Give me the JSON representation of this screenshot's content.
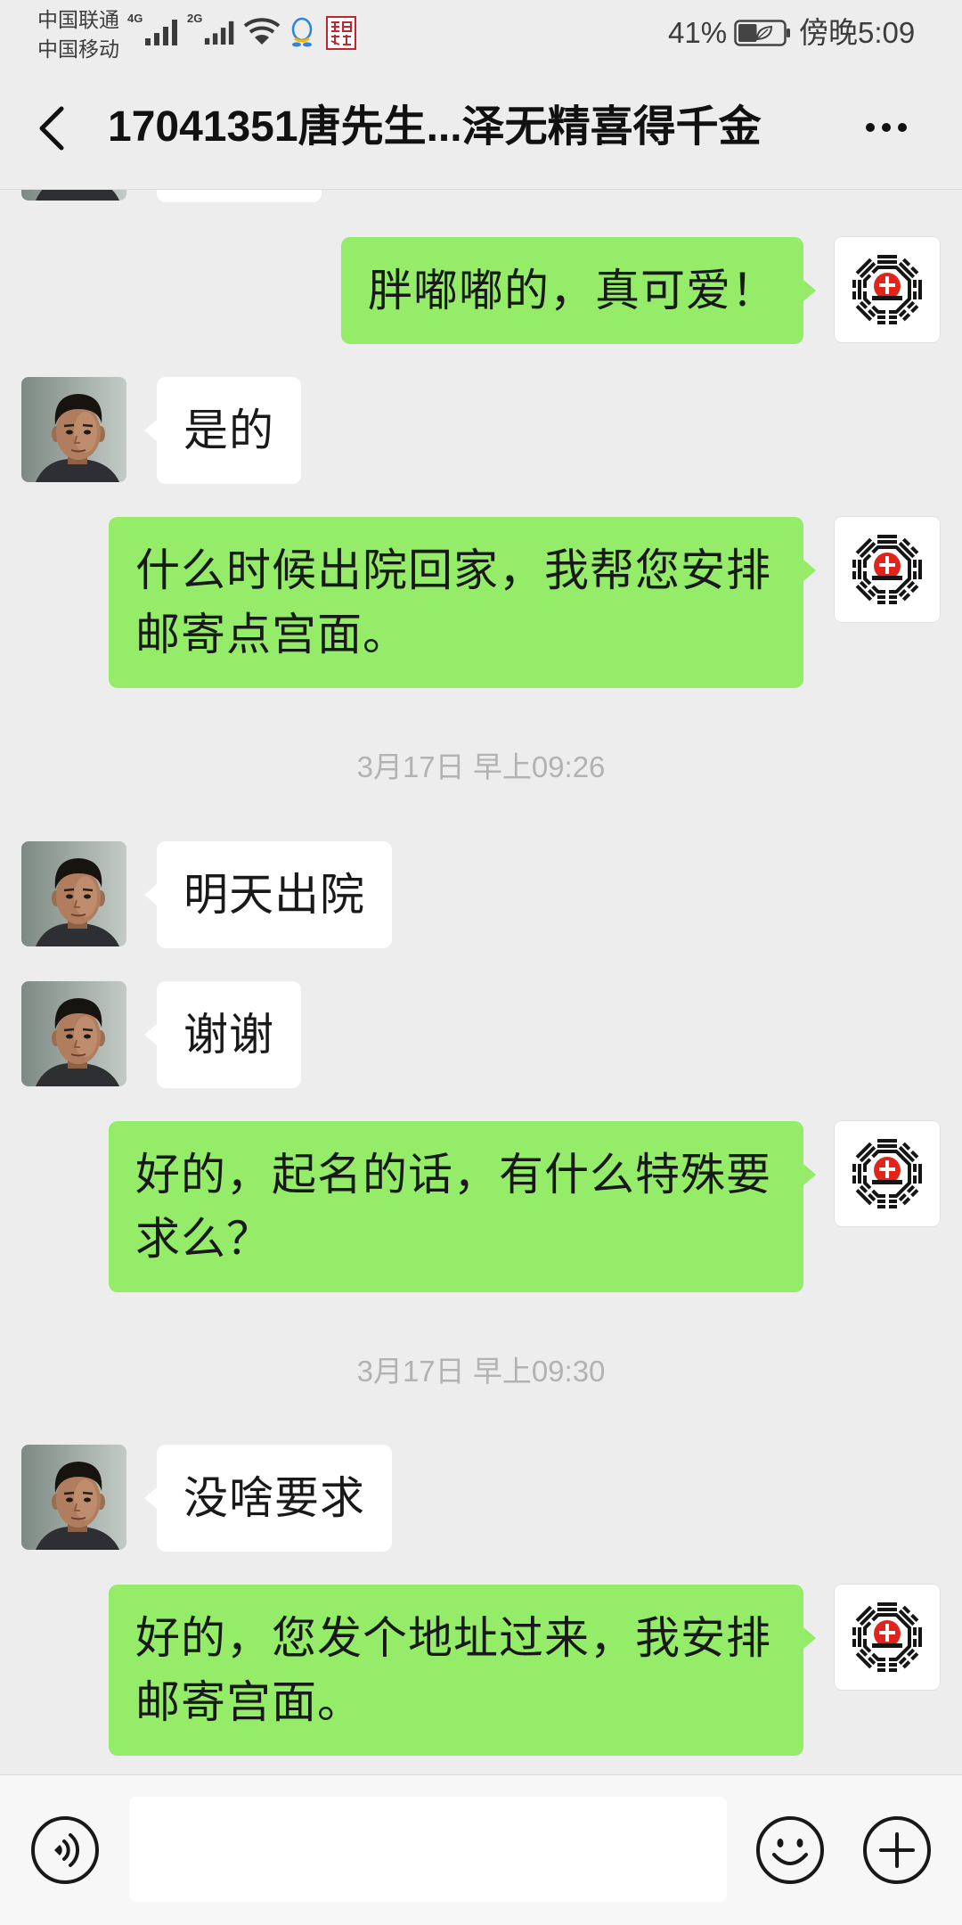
{
  "status_bar": {
    "carrier_primary": "中国联通",
    "carrier_secondary": "中国移动",
    "network_primary": "4G",
    "network_secondary": "2G",
    "battery": "41%",
    "time": "傍晚5:09"
  },
  "header": {
    "title": "17041351唐先生...泽无精喜得千金"
  },
  "chat": [
    {
      "outgoing": "胖嘟嘟的，真可爱！"
    },
    {
      "incoming": "是的"
    },
    {
      "outgoing": "什么时候出院回家，我帮您安排邮寄点宫面。"
    },
    {
      "timestamp": "3月17日 早上09:26"
    },
    {
      "incoming": "明天出院"
    },
    {
      "incoming": "谢谢"
    },
    {
      "outgoing": "好的，起名的话，有什么特殊要求么？"
    },
    {
      "timestamp": "3月17日 早上09:30"
    },
    {
      "incoming": "没啥要求"
    },
    {
      "outgoing": "好的，您发个地址过来，我安排邮寄宫面。"
    }
  ],
  "input_bar": {
    "value": ""
  },
  "icons": {
    "back": "chevron-left-icon",
    "more": "more-dots-icon",
    "voice": "voice-input-icon",
    "emoji": "emoji-icon",
    "add": "plus-circle-icon",
    "contact_avatar": "contact-photo-avatar",
    "self_avatar": "bagua-logo-avatar",
    "signal": "signal-bars-icon",
    "wifi": "wifi-icon",
    "qq": "qq-icon",
    "seal": "red-seal-icon",
    "battery": "battery-icon"
  },
  "colors": {
    "background": "#ededed",
    "outgoing_bubble": "#95ec69",
    "incoming_bubble": "#ffffff",
    "timestamp_text": "#b2b2b2",
    "text": "#191919"
  }
}
